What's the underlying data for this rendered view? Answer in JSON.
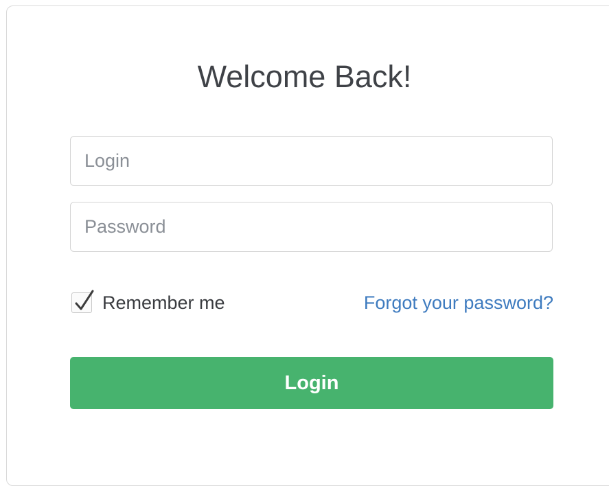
{
  "form": {
    "title": "Welcome Back!",
    "login_placeholder": "Login",
    "login_value": "",
    "password_placeholder": "Password",
    "password_value": "",
    "remember_me_label": "Remember me",
    "remember_me_checked": true,
    "forgot_password_label": "Forgot your password?",
    "submit_label": "Login"
  },
  "colors": {
    "accent": "#47b36e",
    "link": "#3e7bbf",
    "title_text": "#3f4247",
    "border": "#d4d4d4"
  },
  "icons": {
    "checkbox_mark": "checkmark-icon"
  }
}
